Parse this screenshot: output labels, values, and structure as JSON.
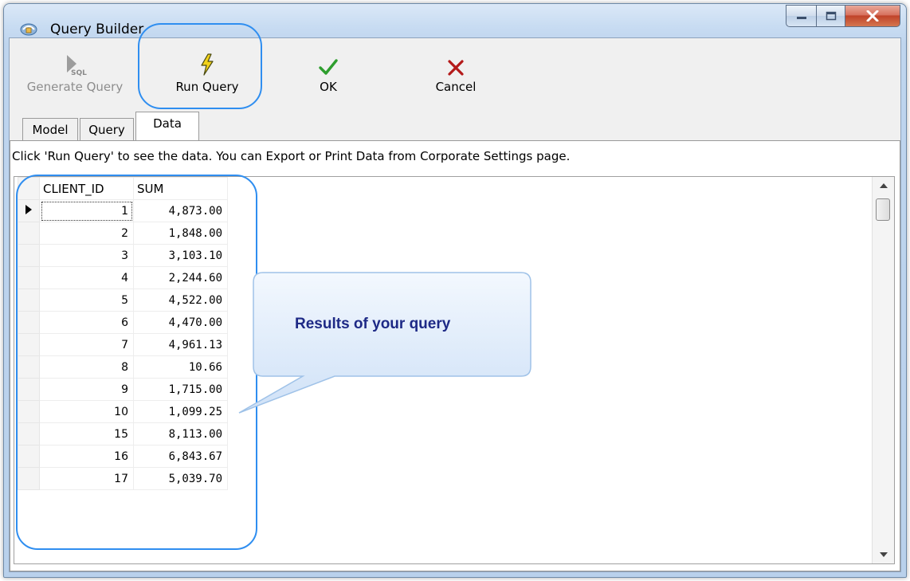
{
  "window": {
    "title": "Query Builder",
    "icon": "app-icon"
  },
  "toolbar": {
    "buttons": [
      {
        "label": "Generate Query",
        "icon": "generate-sql-icon",
        "enabled": false
      },
      {
        "label": "Run Query",
        "icon": "lightning-icon",
        "enabled": true
      },
      {
        "label": "OK",
        "icon": "check-icon",
        "enabled": true
      },
      {
        "label": "Cancel",
        "icon": "cancel-x-icon",
        "enabled": true
      }
    ]
  },
  "tabs": [
    {
      "label": "Model",
      "active": false
    },
    {
      "label": "Query",
      "active": false
    },
    {
      "label": "Data",
      "active": true
    }
  ],
  "hint": "Click 'Run Query' to see the data. You can Export or Print Data from Corporate Settings page.",
  "grid": {
    "columns": [
      "CLIENT_ID",
      "SUM"
    ],
    "rows": [
      [
        "1",
        "4,873.00"
      ],
      [
        "2",
        "1,848.00"
      ],
      [
        "3",
        "3,103.10"
      ],
      [
        "4",
        "2,244.60"
      ],
      [
        "5",
        "4,522.00"
      ],
      [
        "6",
        "4,470.00"
      ],
      [
        "7",
        "4,961.13"
      ],
      [
        "8",
        "10.66"
      ],
      [
        "9",
        "1,715.00"
      ],
      [
        "10",
        "1,099.25"
      ],
      [
        "15",
        "8,113.00"
      ],
      [
        "16",
        "6,843.67"
      ],
      [
        "17",
        "5,039.70"
      ]
    ]
  },
  "annotation": {
    "callout": "Results of your query",
    "highlight_color": "#2f8ef0"
  },
  "colors": {
    "accent": "#2f8ef0",
    "ok_green": "#2e9e2e",
    "cancel_red": "#b41a1a",
    "callout_text": "#1e2a86"
  }
}
